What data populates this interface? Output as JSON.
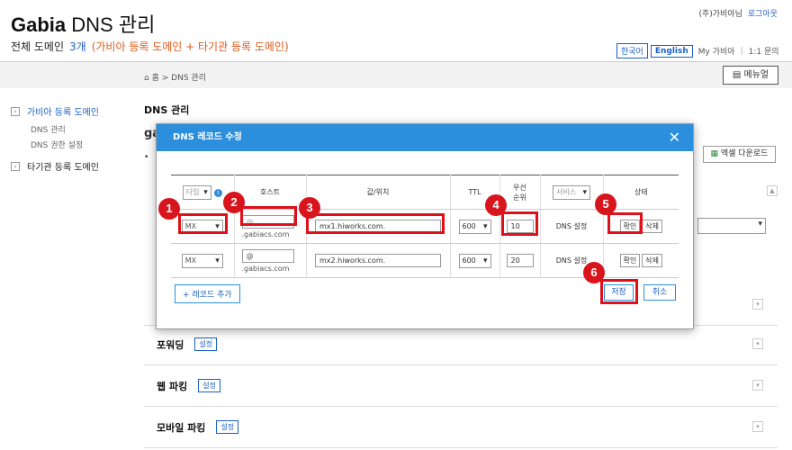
{
  "header": {
    "brand": "Gabia",
    "title_suffix": "DNS 관리",
    "domain_label": "전체 도메인",
    "domain_count": "3개",
    "domain_group": "(가비아 등록 도메인 + 타기관 등록 도메인)",
    "user_text": "(주)가비아님",
    "logout": "로그아웃",
    "lang_ko": "한국어",
    "lang_en": "English",
    "my_gabia": "My 가비아",
    "support": "1:1 문의"
  },
  "breadcrumb": {
    "home": "홈",
    "sep": ">",
    "current": "DNS 관리"
  },
  "manual_button": "메뉴얼",
  "sidebar": {
    "items": [
      {
        "label": "가비아 등록 도메인"
      },
      {
        "label": "타기관 등록 도메인"
      }
    ],
    "subitems": [
      "DNS 관리",
      "DNS 권한 설정"
    ]
  },
  "page": {
    "title": "DNS 관리",
    "excel_button": "엑셀 다운로드",
    "domain_prefix": "ga",
    "sections": [
      {
        "label": "포워딩",
        "btn": "설정"
      },
      {
        "label": "웹 파킹",
        "btn": "설정"
      },
      {
        "label": "모바일 파킹",
        "btn": "설정"
      }
    ]
  },
  "modal": {
    "title": "DNS 레코드 수정",
    "columns": {
      "type": "타입",
      "host": "호스트",
      "value": "값/위치",
      "ttl": "TTL",
      "priority": "우선 순위",
      "service": "서비스",
      "status": "상태"
    },
    "rows": [
      {
        "type": "MX",
        "host": "@",
        "host_suffix": ".gabiacs.com",
        "value": "mx1.hiworks.com.",
        "ttl": "600",
        "priority": "10",
        "service": "DNS 설정",
        "btn_ok": "확인",
        "btn_del": "삭제"
      },
      {
        "type": "MX",
        "host": "@",
        "host_suffix": ".gabiacs.com",
        "value": "mx2.hiworks.com.",
        "ttl": "600",
        "priority": "20",
        "service": "DNS 설정",
        "btn_ok": "확인",
        "btn_del": "삭제"
      }
    ],
    "add_button": "+ 레코드 추가",
    "save_button": "저장",
    "cancel_button": "취소"
  },
  "callouts": [
    "1",
    "2",
    "3",
    "4",
    "5",
    "6"
  ],
  "colors": {
    "accent": "#2b8fde",
    "highlight": "#e0101a",
    "link": "#1b60c6"
  }
}
